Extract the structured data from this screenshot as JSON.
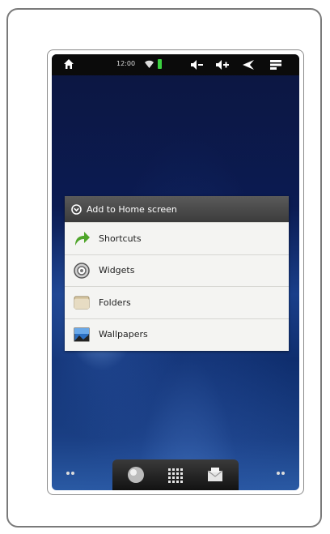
{
  "status_bar": {
    "time": "12:00",
    "battery_color": "#3bd140"
  },
  "dialog": {
    "title": "Add to Home screen",
    "items": [
      {
        "label": "Shortcuts",
        "icon": "shortcut-arrow-icon"
      },
      {
        "label": "Widgets",
        "icon": "widgets-icon"
      },
      {
        "label": "Folders",
        "icon": "folder-icon"
      },
      {
        "label": "Wallpapers",
        "icon": "wallpaper-icon"
      }
    ]
  },
  "dock": {
    "buttons": [
      "browser-globe-icon",
      "app-drawer-grid-icon",
      "email-icon"
    ]
  }
}
